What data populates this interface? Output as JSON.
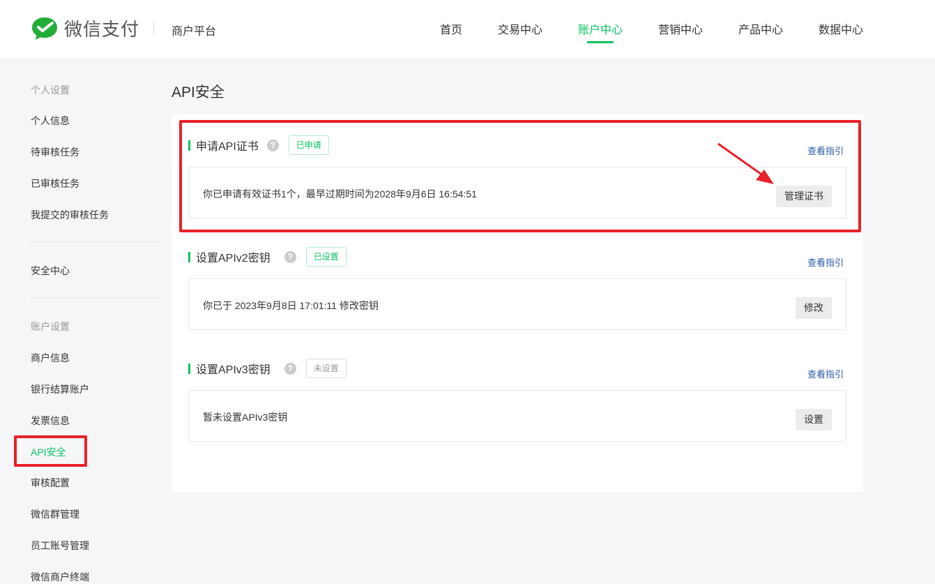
{
  "header": {
    "brand": "微信支付",
    "platform": "商户平台",
    "nav": [
      "首页",
      "交易中心",
      "账户中心",
      "营销中心",
      "产品中心",
      "数据中心"
    ],
    "active_nav": "账户中心"
  },
  "sidebar": {
    "group1": "个人设置",
    "items1": [
      "个人信息",
      "待审核任务",
      "已审核任务",
      "我提交的审核任务"
    ],
    "security": "安全中心",
    "group2": "账户设置",
    "items2": [
      "商户信息",
      "银行结算账户",
      "发票信息",
      "API安全",
      "审核配置",
      "微信群管理",
      "员工账号管理",
      "微信商户终端"
    ]
  },
  "page_title": "API安全",
  "sections": [
    {
      "title": "申请API证书",
      "help": "?",
      "badge": "已申请",
      "guide": "查看指引",
      "text": "你已申请有效证书1个，最早过期时间为2028年9月6日 16:54:51",
      "button": "管理证书"
    },
    {
      "title": "设置APIv2密钥",
      "help": "?",
      "badge": "已设置",
      "guide": "查看指引",
      "text": "你已于 2023年9月8日 17:01:11 修改密钥",
      "button": "修改"
    },
    {
      "title": "设置APIv3密钥",
      "help": "?",
      "badge": "未设置",
      "guide": "查看指引",
      "text": "暂未设置APIv3密钥",
      "button": "设置"
    }
  ],
  "colors": {
    "accent": "#07c160",
    "highlight": "#e8202a",
    "link": "#2b5aa8"
  }
}
